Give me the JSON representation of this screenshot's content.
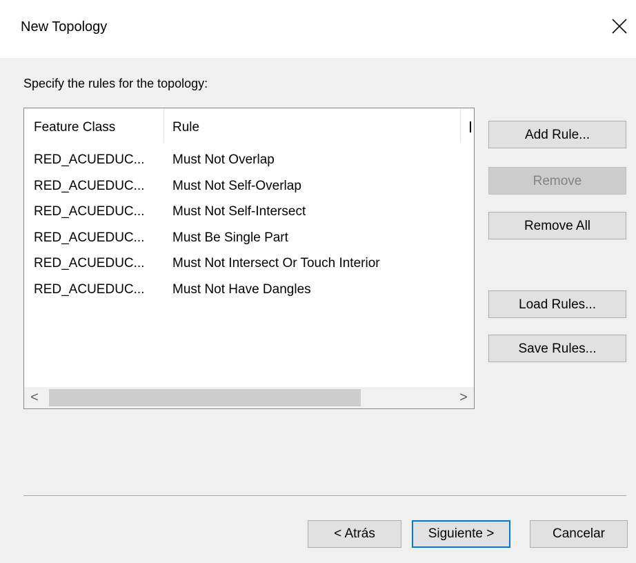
{
  "window": {
    "title": "New Topology",
    "close_icon": "close-icon"
  },
  "instruction": "Specify the rules for the topology:",
  "rules_list": {
    "columns": [
      "Feature Class",
      "Rule",
      ""
    ],
    "rows": [
      {
        "feature_class": "RED_ACUEDUC...",
        "rule": "Must Not Overlap"
      },
      {
        "feature_class": "RED_ACUEDUC...",
        "rule": "Must Not Self-Overlap"
      },
      {
        "feature_class": "RED_ACUEDUC...",
        "rule": "Must Not Self-Intersect"
      },
      {
        "feature_class": "RED_ACUEDUC...",
        "rule": "Must Be Single Part"
      },
      {
        "feature_class": "RED_ACUEDUC...",
        "rule": "Must Not Intersect Or Touch Interior"
      },
      {
        "feature_class": "RED_ACUEDUC...",
        "rule": "Must Not Have Dangles"
      }
    ],
    "scroll_left_icon": "<",
    "scroll_right_icon": ">"
  },
  "side_buttons": {
    "add_rule": "Add Rule...",
    "remove": "Remove",
    "remove_all": "Remove All",
    "load_rules": "Load Rules...",
    "save_rules": "Save Rules..."
  },
  "footer": {
    "back": "< Atrás",
    "next": "Siguiente >",
    "cancel": "Cancelar"
  },
  "colors": {
    "dialog_bg": "#f0f0f0",
    "default_button_border": "#0078d7",
    "disabled_text": "#838383"
  }
}
